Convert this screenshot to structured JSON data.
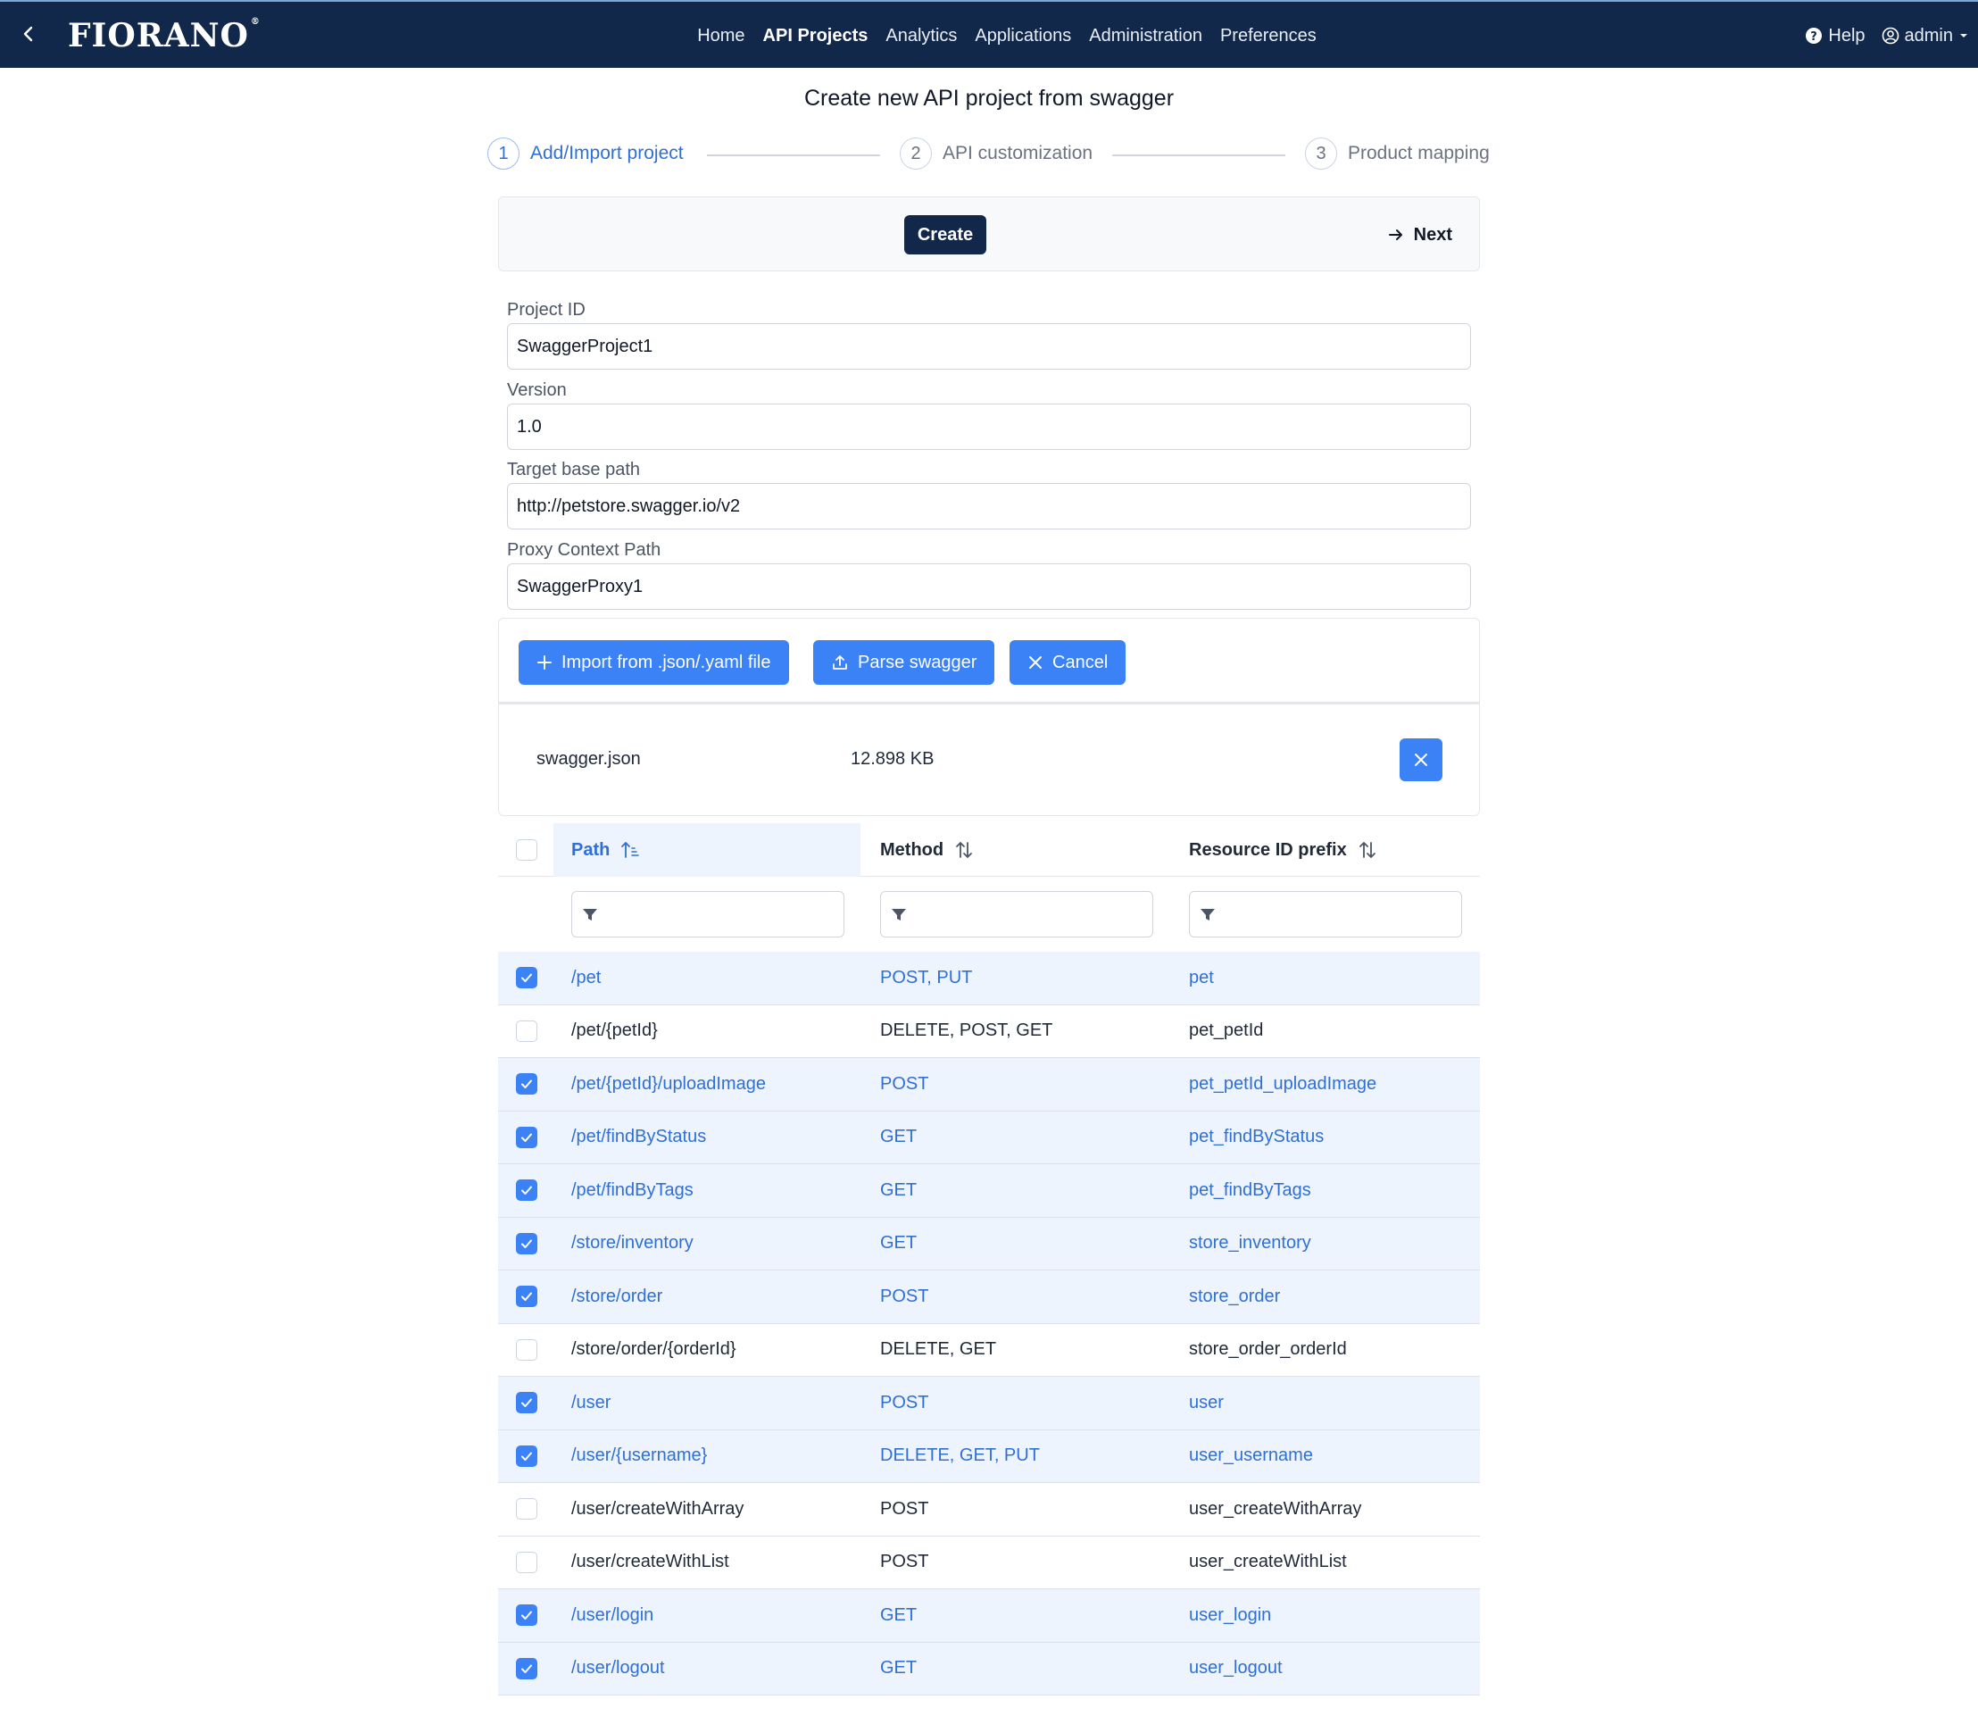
{
  "nav": {
    "logo": "FIORANO",
    "items": [
      {
        "label": "Home",
        "active": false
      },
      {
        "label": "API Projects",
        "active": true
      },
      {
        "label": "Analytics",
        "active": false
      },
      {
        "label": "Applications",
        "active": false
      },
      {
        "label": "Administration",
        "active": false
      },
      {
        "label": "Preferences",
        "active": false
      }
    ],
    "help": "Help",
    "user": "admin"
  },
  "page_title": "Create new API project from swagger",
  "steps": [
    {
      "num": "1",
      "label": "Add/Import project",
      "active": true
    },
    {
      "num": "2",
      "label": "API customization",
      "active": false
    },
    {
      "num": "3",
      "label": "Product mapping",
      "active": false
    }
  ],
  "toolbar": {
    "create": "Create",
    "next": "Next"
  },
  "form": {
    "project_id": {
      "label": "Project ID",
      "value": "SwaggerProject1"
    },
    "version": {
      "label": "Version",
      "value": "1.0"
    },
    "target_base_path": {
      "label": "Target base path",
      "value": "http://petstore.swagger.io/v2"
    },
    "proxy_context_path": {
      "label": "Proxy Context Path",
      "value": "SwaggerProxy1"
    }
  },
  "upload": {
    "import_label": "Import from .json/.yaml file",
    "parse_label": "Parse swagger",
    "cancel_label": "Cancel",
    "file_name": "swagger.json",
    "file_size": "12.898 KB"
  },
  "table": {
    "columns": [
      "Path",
      "Method",
      "Resource ID prefix"
    ],
    "rows": [
      {
        "path": "/pet",
        "method": "POST, PUT",
        "prefix": "pet",
        "checked": true
      },
      {
        "path": "/pet/{petId}",
        "method": "DELETE, POST, GET",
        "prefix": "pet_petId",
        "checked": false
      },
      {
        "path": "/pet/{petId}/uploadImage",
        "method": "POST",
        "prefix": "pet_petId_uploadImage",
        "checked": true
      },
      {
        "path": "/pet/findByStatus",
        "method": "GET",
        "prefix": "pet_findByStatus",
        "checked": true
      },
      {
        "path": "/pet/findByTags",
        "method": "GET",
        "prefix": "pet_findByTags",
        "checked": true
      },
      {
        "path": "/store/inventory",
        "method": "GET",
        "prefix": "store_inventory",
        "checked": true
      },
      {
        "path": "/store/order",
        "method": "POST",
        "prefix": "store_order",
        "checked": true
      },
      {
        "path": "/store/order/{orderId}",
        "method": "DELETE, GET",
        "prefix": "store_order_orderId",
        "checked": false
      },
      {
        "path": "/user",
        "method": "POST",
        "prefix": "user",
        "checked": true
      },
      {
        "path": "/user/{username}",
        "method": "DELETE, GET, PUT",
        "prefix": "user_username",
        "checked": true
      },
      {
        "path": "/user/createWithArray",
        "method": "POST",
        "prefix": "user_createWithArray",
        "checked": false
      },
      {
        "path": "/user/createWithList",
        "method": "POST",
        "prefix": "user_createWithList",
        "checked": false
      },
      {
        "path": "/user/login",
        "method": "GET",
        "prefix": "user_login",
        "checked": true
      },
      {
        "path": "/user/logout",
        "method": "GET",
        "prefix": "user_logout",
        "checked": true
      }
    ]
  },
  "colors": {
    "navy": "#12284a",
    "accent": "#3b82f6",
    "selected_row": "#eef4fd",
    "selected_text": "#2f6fd6"
  }
}
